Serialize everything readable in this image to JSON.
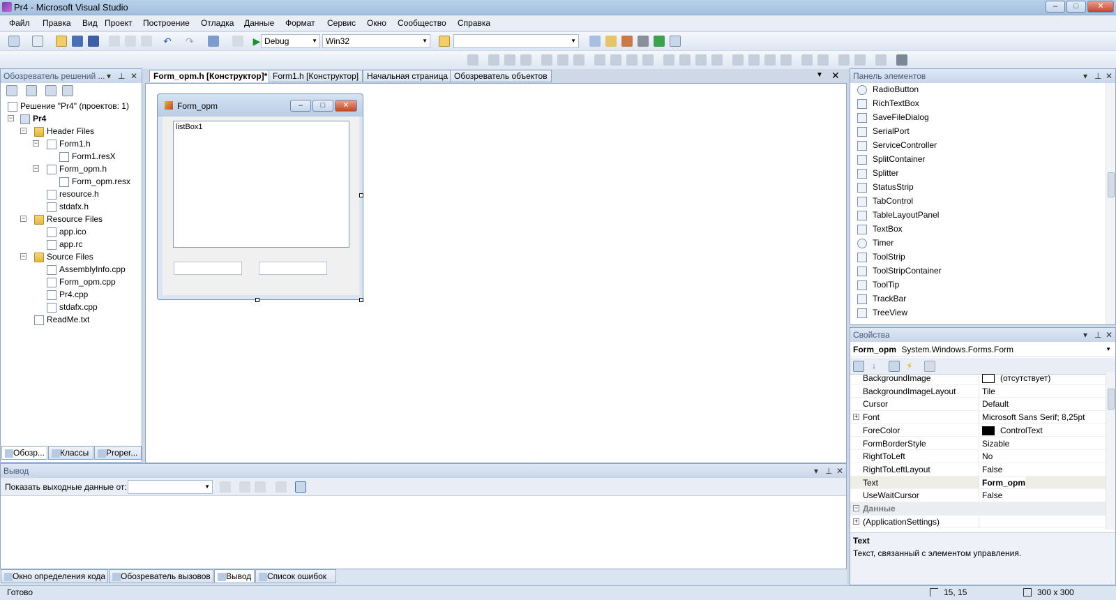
{
  "window": {
    "title": "Pr4 - Microsoft Visual Studio",
    "min": "–",
    "max": "□",
    "close": "✕"
  },
  "menu": [
    "Файл",
    "Правка",
    "Вид",
    "Проект",
    "Построение",
    "Отладка",
    "Данные",
    "Формат",
    "Сервис",
    "Окно",
    "Сообщество",
    "Справка"
  ],
  "toolbar": {
    "config": "Debug",
    "platform": "Win32"
  },
  "solution_explorer": {
    "title": "Обозреватель решений ...",
    "solution": "Решение \"Pr4\" (проектов: 1)",
    "project": "Pr4",
    "items": [
      "Header Files",
      "Form1.h",
      "Form1.resX",
      "Form_opm.h",
      "Form_opm.resx",
      "resource.h",
      "stdafx.h",
      "Resource Files",
      "app.ico",
      "app.rc",
      "Source Files",
      "AssemblyInfo.cpp",
      "Form_opm.cpp",
      "Pr4.cpp",
      "stdafx.cpp",
      "ReadMe.txt"
    ],
    "tabs": [
      "Обозр...",
      "Классы",
      "Proper..."
    ]
  },
  "doc_tabs": [
    "Form_opm.h [Конструктор]*",
    "Form1.h [Конструктор]",
    "Начальная страница",
    "Обозреватель объектов"
  ],
  "designer": {
    "form_title": "Form_opm",
    "listbox_label": "listBox1"
  },
  "toolbox": {
    "title": "Панель элементов",
    "items": [
      "RadioButton",
      "RichTextBox",
      "SaveFileDialog",
      "SerialPort",
      "ServiceController",
      "SplitContainer",
      "Splitter",
      "StatusStrip",
      "TabControl",
      "TableLayoutPanel",
      "TextBox",
      "Timer",
      "ToolStrip",
      "ToolStripContainer",
      "ToolTip",
      "TrackBar",
      "TreeView"
    ]
  },
  "properties": {
    "title": "Свойства",
    "object_name": "Form_opm",
    "object_type": "System.Windows.Forms.Form",
    "rows": [
      {
        "name": "BackgroundImage",
        "value": "(отсутствует)"
      },
      {
        "name": "BackgroundImageLayout",
        "value": "Tile"
      },
      {
        "name": "Cursor",
        "value": "Default"
      },
      {
        "name": "Font",
        "value": "Microsoft Sans Serif; 8,25pt"
      },
      {
        "name": "ForeColor",
        "value": "ControlText"
      },
      {
        "name": "FormBorderStyle",
        "value": "Sizable"
      },
      {
        "name": "RightToLeft",
        "value": "No"
      },
      {
        "name": "RightToLeftLayout",
        "value": "False"
      },
      {
        "name": "Text",
        "value": "Form_opm"
      },
      {
        "name": "UseWaitCursor",
        "value": "False"
      }
    ],
    "category_data": "Данные",
    "app_settings": "(ApplicationSettings)",
    "desc_title": "Text",
    "desc_text": "Текст, связанный с элементом управления."
  },
  "output": {
    "title": "Вывод",
    "show_label": "Показать выходные данные от:"
  },
  "bottom_tabs": [
    "Окно определения кода",
    "Обозреватель вызовов",
    "Вывод",
    "Список ошибок"
  ],
  "status": {
    "text": "Готово",
    "position": "15, 15",
    "size": "300 x 300"
  }
}
